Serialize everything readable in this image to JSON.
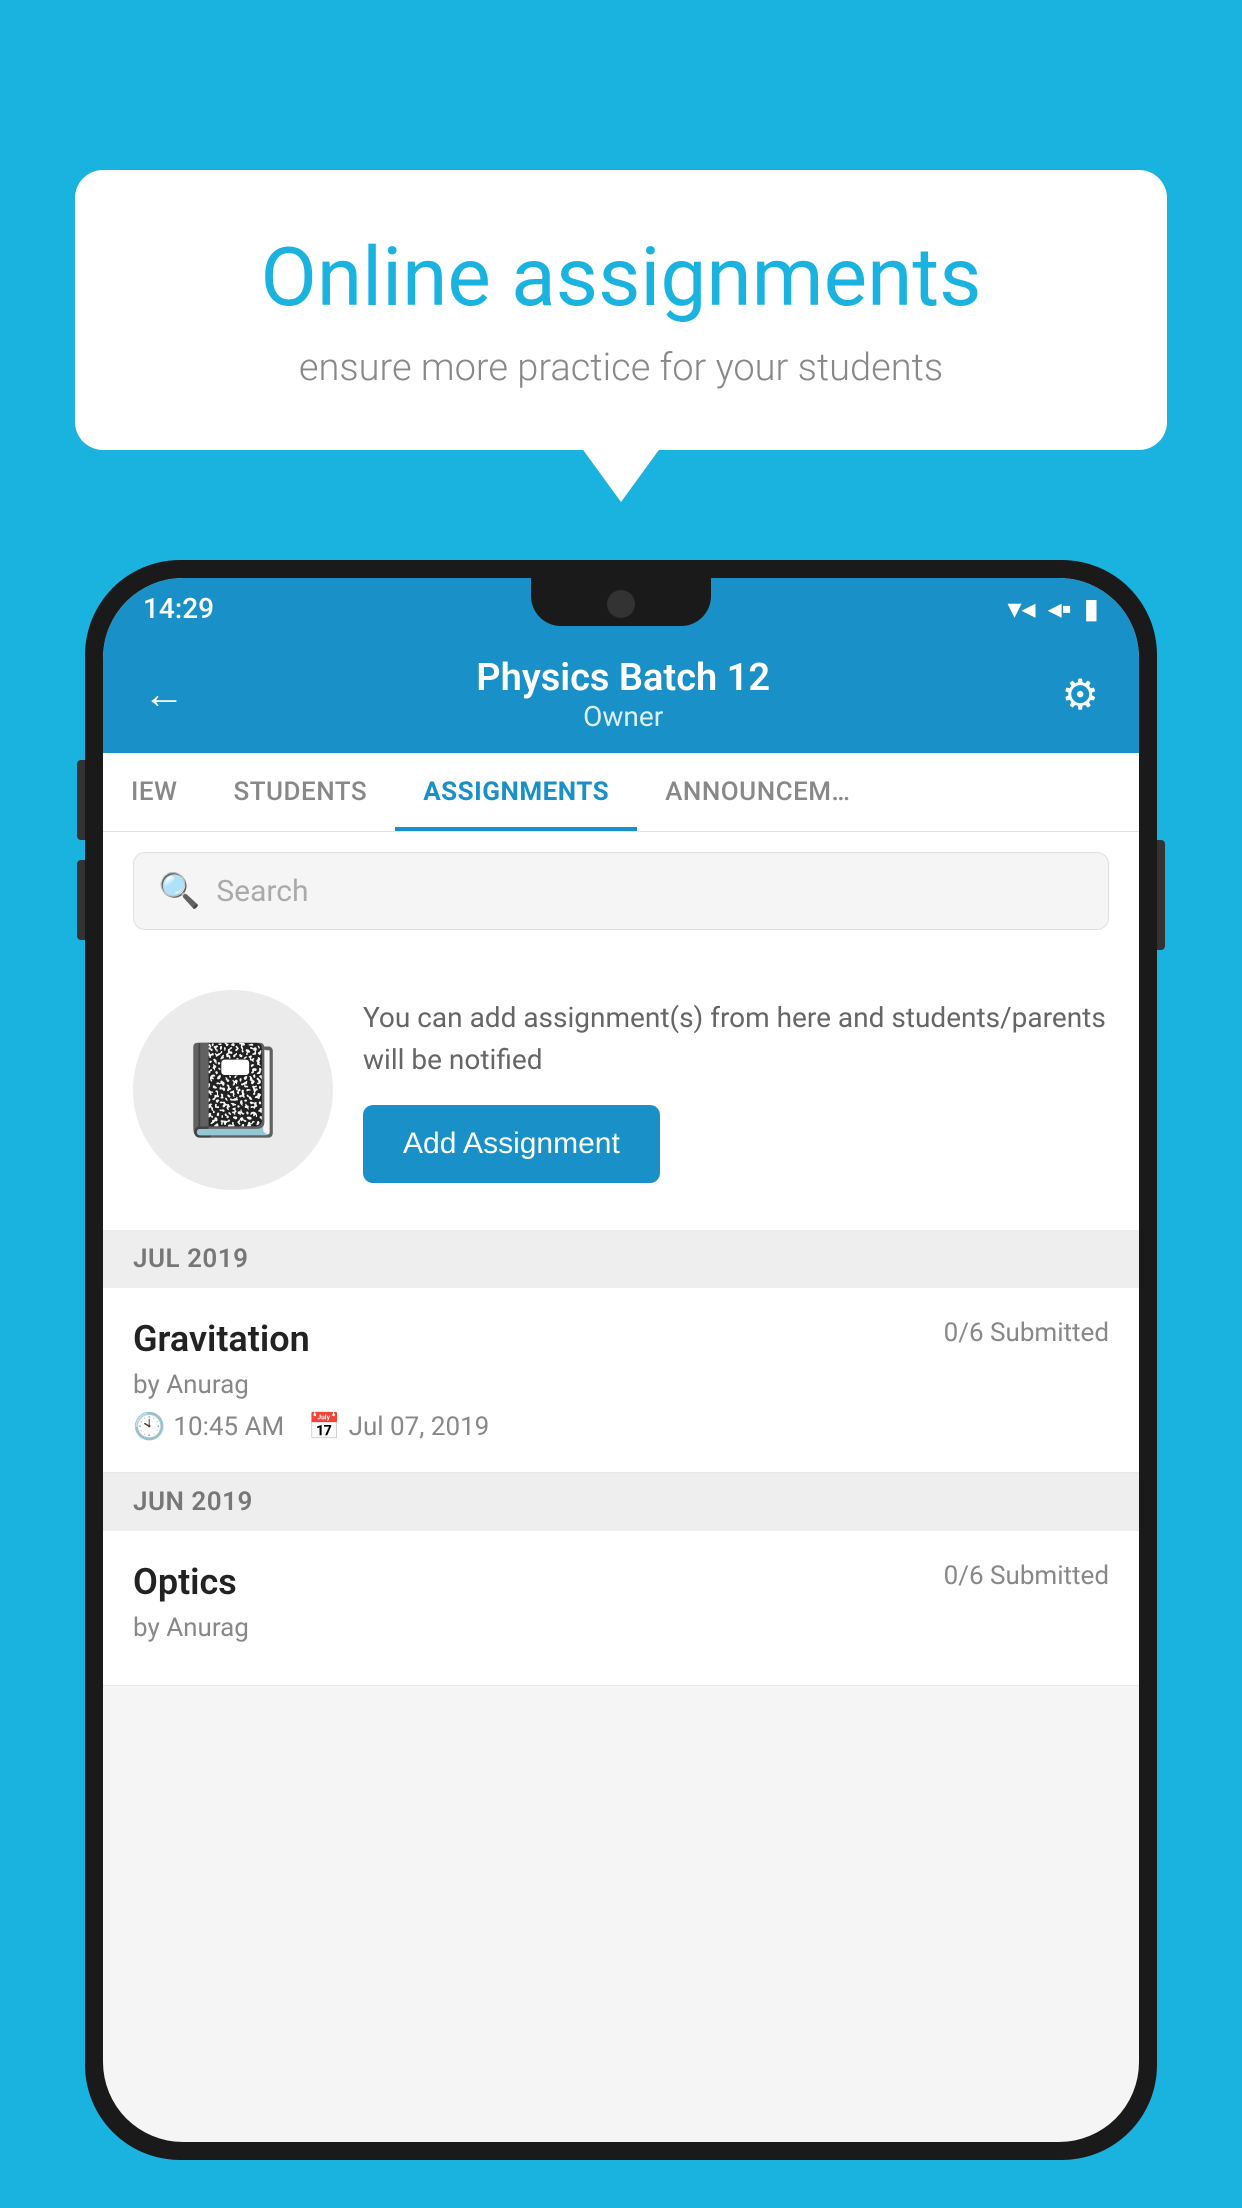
{
  "background_color": "#1ab3e0",
  "speech_bubble": {
    "title": "Online assignments",
    "subtitle": "ensure more practice for your students"
  },
  "phone": {
    "status_bar": {
      "time": "14:29",
      "icons": [
        "wifi",
        "signal",
        "battery"
      ]
    },
    "header": {
      "title": "Physics Batch 12",
      "subtitle": "Owner",
      "back_label": "←",
      "settings_label": "⚙"
    },
    "tabs": [
      {
        "label": "IEW",
        "active": false
      },
      {
        "label": "STUDENTS",
        "active": false
      },
      {
        "label": "ASSIGNMENTS",
        "active": true
      },
      {
        "label": "ANNOUNCEM…",
        "active": false
      }
    ],
    "search": {
      "placeholder": "Search"
    },
    "add_assignment_section": {
      "description": "You can add assignment(s) from here and students/parents will be notified",
      "button_label": "Add Assignment"
    },
    "assignment_groups": [
      {
        "month": "JUL 2019",
        "assignments": [
          {
            "title": "Gravitation",
            "submitted": "0/6 Submitted",
            "author": "by Anurag",
            "time": "10:45 AM",
            "date": "Jul 07, 2019"
          }
        ]
      },
      {
        "month": "JUN 2019",
        "assignments": [
          {
            "title": "Optics",
            "submitted": "0/6 Submitted",
            "author": "by Anurag",
            "time": "",
            "date": ""
          }
        ]
      }
    ]
  }
}
